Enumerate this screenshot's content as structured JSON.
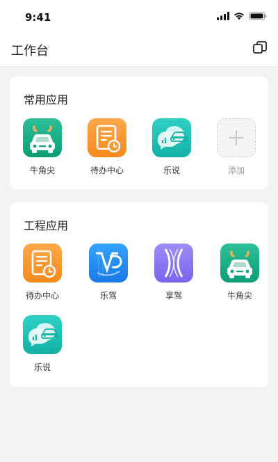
{
  "status": {
    "time": "9:41"
  },
  "header": {
    "title": "工作台"
  },
  "common_section": {
    "title": "常用应用",
    "apps": [
      {
        "label": "牛角尖",
        "icon": "car-horns-icon"
      },
      {
        "label": "待办中心",
        "icon": "todo-document-icon"
      },
      {
        "label": "乐说",
        "icon": "chat-car-icon"
      },
      {
        "label": "添加",
        "icon": "plus-icon"
      }
    ]
  },
  "engineering_section": {
    "title": "工程应用",
    "apps": [
      {
        "label": "待办中心",
        "icon": "todo-document-icon"
      },
      {
        "label": "乐驾",
        "icon": "vp-logo-icon"
      },
      {
        "label": "享驾",
        "icon": "road-x-icon"
      },
      {
        "label": "牛角尖",
        "icon": "car-horns-icon"
      },
      {
        "label": "乐说",
        "icon": "chat-car-icon"
      }
    ]
  },
  "colors": {
    "green": "#13a97f",
    "orange": "#f7972c",
    "teal": "#1fc1b4",
    "blue": "#2a8ff5",
    "purple": "#8a75f2",
    "background": "#f3f3f4"
  }
}
